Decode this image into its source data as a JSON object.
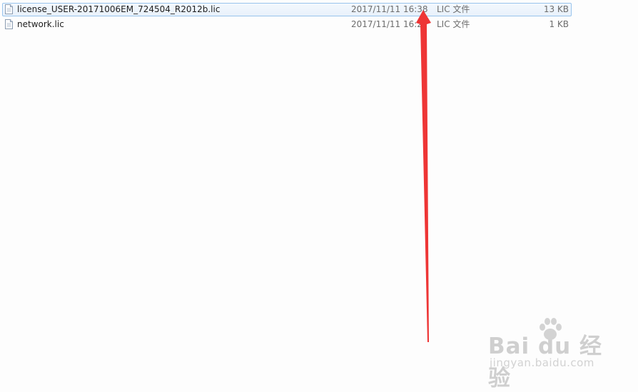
{
  "files": [
    {
      "name": "license_USER-20171006EM_724504_R2012b.lic",
      "modified": "2017/11/11 16:38",
      "type": "LIC 文件",
      "size": "13 KB",
      "selected": true,
      "icon": "document-icon"
    },
    {
      "name": "network.lic",
      "modified": "2017/11/11 16:2",
      "type": "LIC 文件",
      "size": "1 KB",
      "selected": false,
      "icon": "document-icon"
    }
  ],
  "annotation": {
    "arrow_color": "#ee3535"
  },
  "watermark": {
    "brand": "Bai du 经验",
    "url": "jingyan.baidu.com"
  }
}
